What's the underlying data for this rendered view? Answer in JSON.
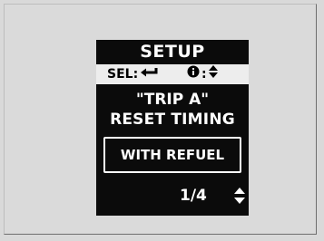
{
  "display": {
    "title": "SETUP",
    "hints": {
      "select_label": "SEL:",
      "select_icon": "enter-arrow-icon",
      "info_icon": "info-icon",
      "info_separator": ":",
      "scroll_icon": "up-down-arrows-icon"
    },
    "setting_name": "\"TRIP A\"",
    "setting_subtitle": "RESET TIMING",
    "selected_option": "WITH REFUEL",
    "page_indicator": "1/4",
    "colors": {
      "screen_black": "#0b0b0b",
      "screen_white": "#ffffff",
      "hint_background": "#ededed",
      "page_background": "#d9d9d9"
    }
  }
}
